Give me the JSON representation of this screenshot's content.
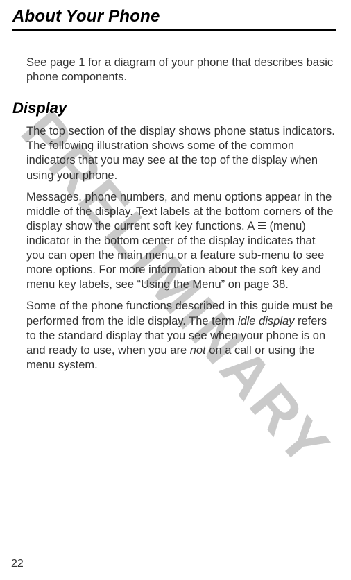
{
  "watermark": "PRELIMINARY",
  "title": "About Your Phone",
  "intro": "See page 1 for a diagram of your phone that describes basic phone components.",
  "section_heading": "Display",
  "para1": "The top section of the display shows phone status indicators. The following illustration shows some of the common indicators that you may see at the top of the display when using your phone.",
  "para2_pre": "Messages, phone numbers, and menu options appear in the middle of the display. Text labels at the bottom corners of the display show the current soft key functions. A ",
  "para2_post": " (menu) indicator in the bottom center of the display indicates that you can open the main menu or a feature sub-menu to see more options. For more information about the soft key and menu key labels, see “Using the Menu” on page 38.",
  "para3_pre": "Some of the phone functions described in this guide must be performed from the idle display. The term ",
  "para3_idle": "idle display",
  "para3_mid": " refers to the standard display that you see when your phone is on and ready to use, when you are ",
  "para3_not": "not",
  "para3_post": " on a call or using the menu system.",
  "page_number": "22"
}
